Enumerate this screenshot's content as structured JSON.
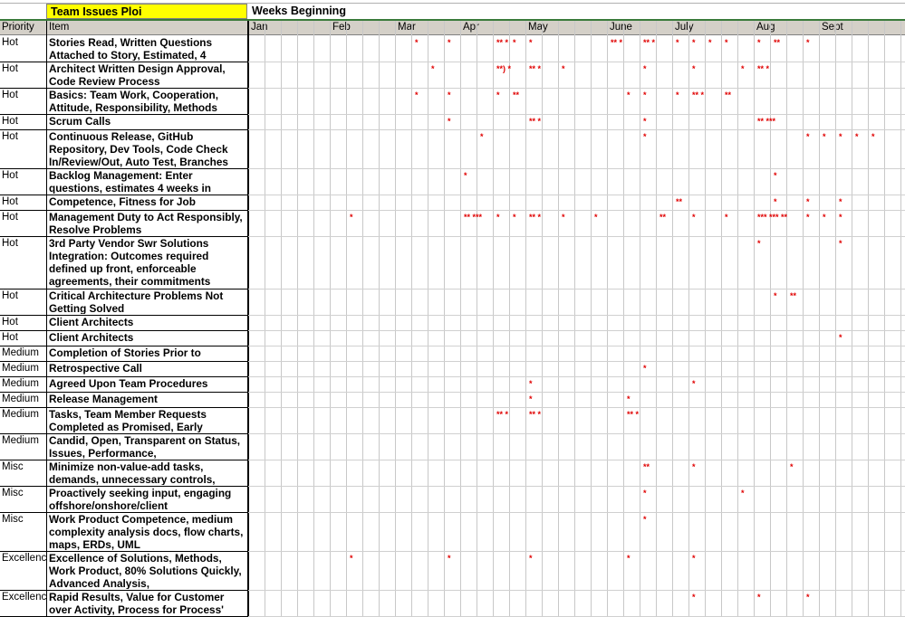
{
  "sheet": {
    "title": "Team Issues Ploi",
    "weeks_label": "Weeks Beginning",
    "col_priority": "Priority",
    "col_item": "Item",
    "months": [
      "Jan",
      "Feb",
      "Mar",
      "Apr",
      "May",
      "June",
      "July",
      "Aug",
      "Sept"
    ]
  },
  "rows": [
    {
      "priority": "Hot",
      "item": "Stories Read, Written Questions Attached to Story, Estimated, 4",
      "marks": {
        "10": "*",
        "12": "*",
        "15": "** *",
        "16": "*",
        "17": "*",
        "22": "** *",
        "24": "** *",
        "26": "*",
        "27": "*",
        "28": "*",
        "29": "*",
        "31": "*",
        "32": "**",
        "34": "*"
      }
    },
    {
      "priority": "Hot",
      "item": "Architect Written Design Approval, Code Review Process",
      "marks": {
        "11": "*",
        "15": "**) *",
        "17": "** *",
        "19": "*",
        "24": "*",
        "27": "*",
        "30": "*",
        "31": "** *"
      }
    },
    {
      "priority": "Hot",
      "item": "Basics: Team Work, Cooperation, Attitude, Responsibility, Methods",
      "marks": {
        "10": "*",
        "12": "*",
        "15": "*",
        "16": "**",
        "23": "*",
        "24": "*",
        "26": "*",
        "27": "** *",
        "29": "**"
      }
    },
    {
      "priority": "Hot",
      "item": "Scrum Calls",
      "marks": {
        "12": "*",
        "17": "** *",
        "24": "*",
        "31": "** ***"
      }
    },
    {
      "priority": "Hot",
      "item": "Continuous Release, GitHub Repository, Dev Tools, Code Check In/Review/Out, Auto Test, Branches",
      "marks": {
        "14": "*",
        "24": "*",
        "34": "*",
        "35": "*",
        "36": "*",
        "37": "*",
        "38": "*"
      }
    },
    {
      "priority": "Hot",
      "item": "Backlog Management:  Enter questions, estimates 4 weeks in",
      "marks": {
        "13": "*",
        "32": "*"
      }
    },
    {
      "priority": "Hot",
      "item": "Competence, Fitness for Job",
      "marks": {
        "26": "**",
        "32": "*",
        "34": "*",
        "36": "*"
      }
    },
    {
      "priority": "Hot",
      "item": "Management Duty to Act Responsibly, Resolve Problems",
      "marks": {
        "6": "*",
        "13": "** ***",
        "15": "*",
        "16": "*",
        "17": "** *",
        "19": "*",
        "21": "*",
        "25": "**",
        "27": "*",
        "29": "*",
        "31": "*** *** **",
        "34": "*",
        "35": "*",
        "36": "*"
      }
    },
    {
      "priority": "Hot",
      "item": "3rd Party Vendor Swr Solutions Integration:  Outcomes required defined up front, enforceable agreements, their commitments",
      "marks": {
        "31": "*",
        "36": "*"
      }
    },
    {
      "priority": "Hot",
      "item": "Critical Architecture Problems Not Getting Solved",
      "marks": {
        "32": "*",
        "33": "**"
      }
    },
    {
      "priority": "Hot",
      "item": "Client Architects",
      "marks": {}
    },
    {
      "priority": "Hot",
      "item": "Client Architects",
      "marks": {
        "36": "*"
      }
    },
    {
      "priority": "Medium",
      "item": "Completion of Stories Prior to",
      "marks": {}
    },
    {
      "priority": "Medium",
      "item": "Retrospective Call",
      "marks": {
        "24": "*"
      }
    },
    {
      "priority": "Medium",
      "item": "Agreed Upon Team Procedures",
      "marks": {
        "17": "*",
        "27": "*"
      }
    },
    {
      "priority": "Medium",
      "item": "Release Management",
      "marks": {
        "17": "*",
        "23": "*"
      }
    },
    {
      "priority": "Medium",
      "item": "Tasks, Team Member Requests Completed as Promised, Early",
      "marks": {
        "15": "** *",
        "17": "** *",
        "23": "** *"
      }
    },
    {
      "priority": "Medium",
      "item": "Candid, Open, Transparent on Status, Issues, Performance,",
      "marks": {}
    },
    {
      "priority": "Misc",
      "item": "Minimize non-value-add tasks, demands,  unnecessary controls,",
      "marks": {
        "24": "**",
        "27": "*",
        "33": "*"
      }
    },
    {
      "priority": "Misc",
      "item": "Proactively seeking input, engaging offshore/onshore/client",
      "marks": {
        "24": "*",
        "30": "*"
      }
    },
    {
      "priority": "Misc",
      "item": "Work Product Competence, medium complexity analysis docs, flow charts, maps, ERDs, UML",
      "marks": {
        "24": "*"
      }
    },
    {
      "priority": "Excellence",
      "item": "Excellence of Solutions, Methods, Work Product, 80% Solutions Quickly, Advanced Analysis,",
      "marks": {
        "6": "*",
        "12": "*",
        "17": "*",
        "23": "*",
        "27": "*"
      }
    },
    {
      "priority": "Excellence",
      "item": "Rapid Results, Value for Customer over Activity, Process for Process'",
      "marks": {
        "27": "*",
        "31": "*",
        "34": "*"
      }
    }
  ]
}
